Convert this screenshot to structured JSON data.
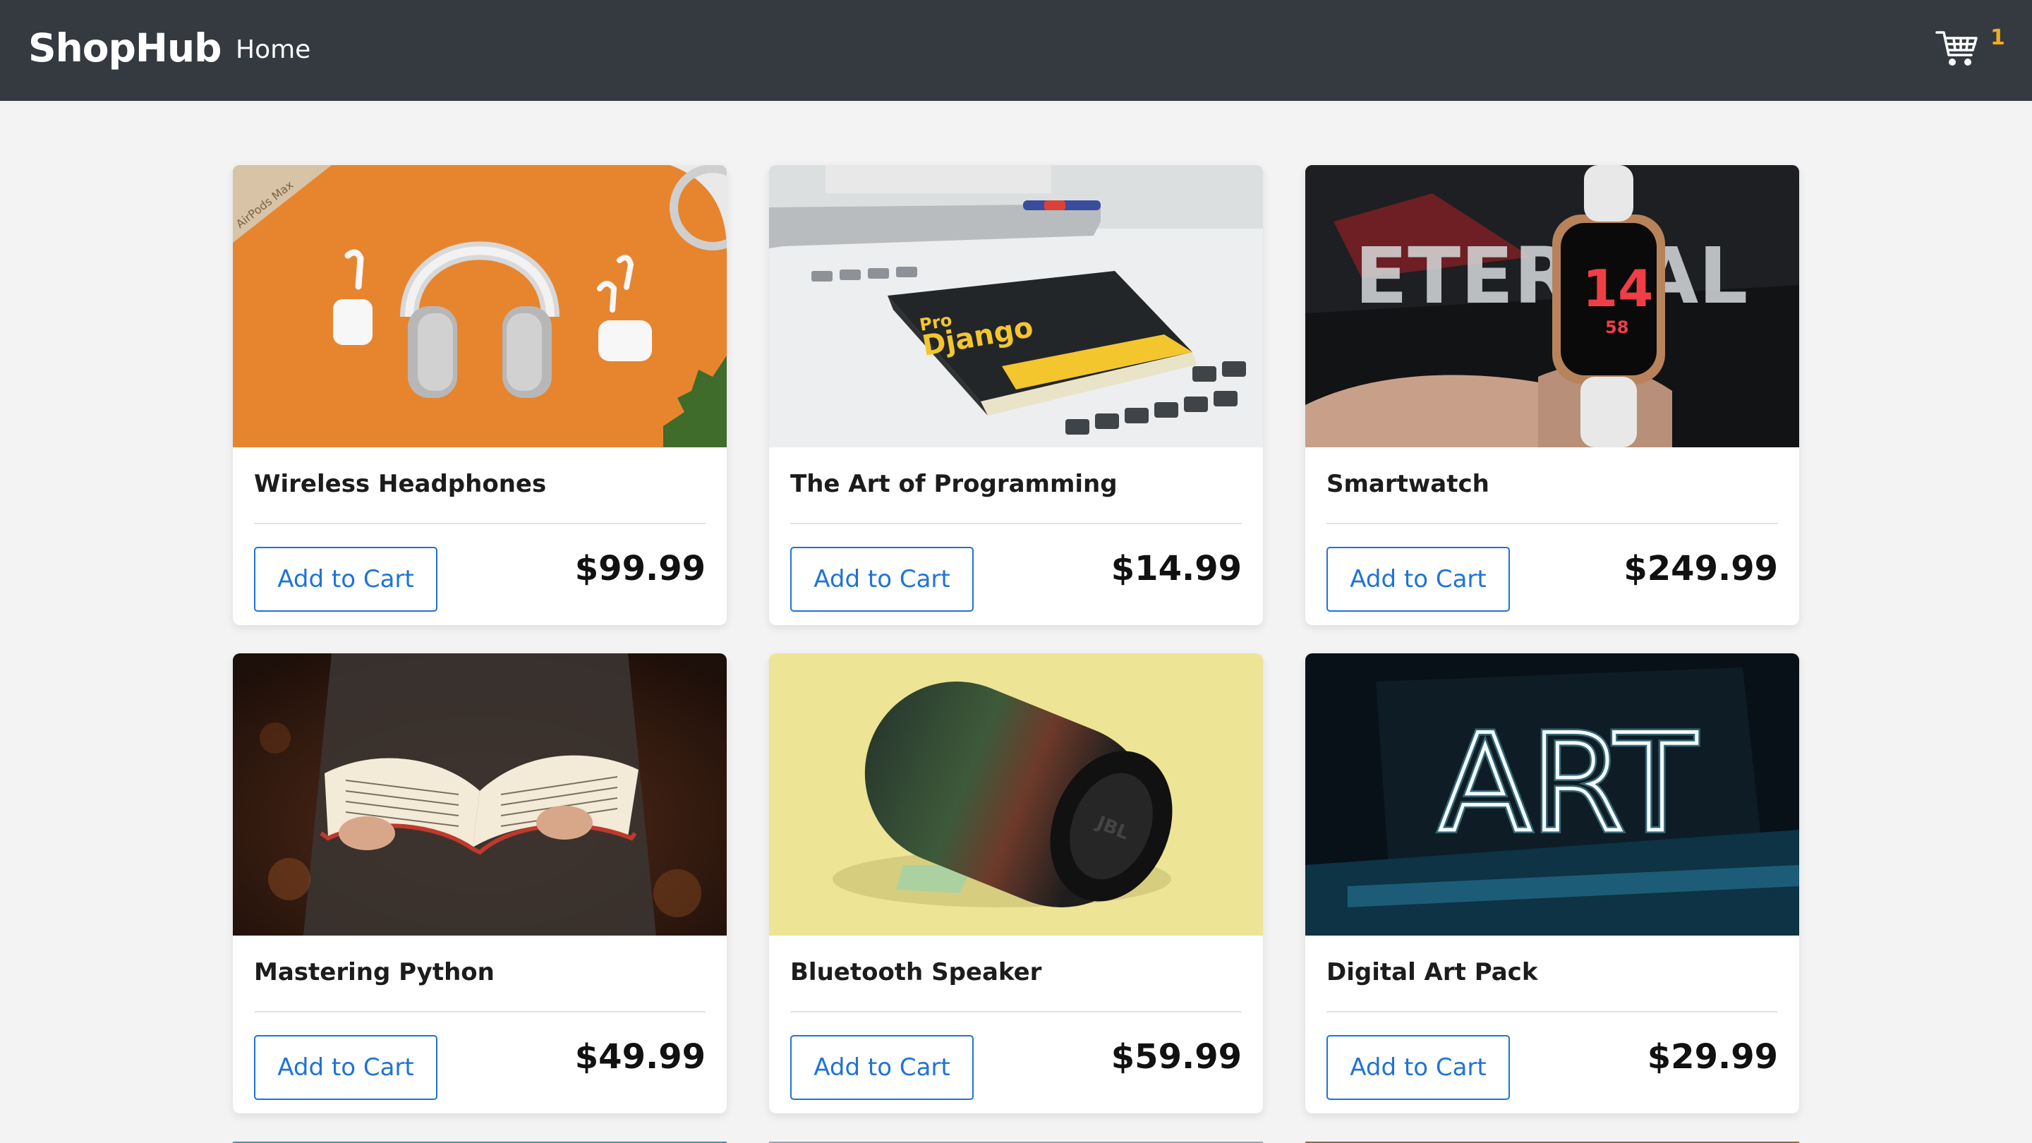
{
  "header": {
    "brand": "ShopHub",
    "nav_home": "Home",
    "cart_count": "1"
  },
  "products": [
    {
      "name": "Wireless Headphones",
      "price": "$99.99",
      "button": "Add to Cart"
    },
    {
      "name": "The Art of Programming",
      "price": "$14.99",
      "button": "Add to Cart"
    },
    {
      "name": "Smartwatch",
      "price": "$249.99",
      "button": "Add to Cart"
    },
    {
      "name": "Mastering Python",
      "price": "$49.99",
      "button": "Add to Cart"
    },
    {
      "name": "Bluetooth Speaker",
      "price": "$59.99",
      "button": "Add to Cart"
    },
    {
      "name": "Digital Art Pack",
      "price": "$29.99",
      "button": "Add to Cart"
    }
  ],
  "image_text": {
    "box_label": "AirPods Max",
    "book_title_1": "Pro",
    "book_title_2": "Django",
    "watch_hour": "14",
    "watch_minute": "58",
    "shirt_text": "ETERNAL",
    "speaker_brand": "JBL",
    "neon_text": "ART"
  },
  "colors": {
    "header_bg": "#343a40",
    "accent_blue": "#1f73d6",
    "cart_badge": "#f0ad1f",
    "page_bg": "#f3f3f3"
  },
  "icons": [
    "shopping-cart-icon"
  ]
}
